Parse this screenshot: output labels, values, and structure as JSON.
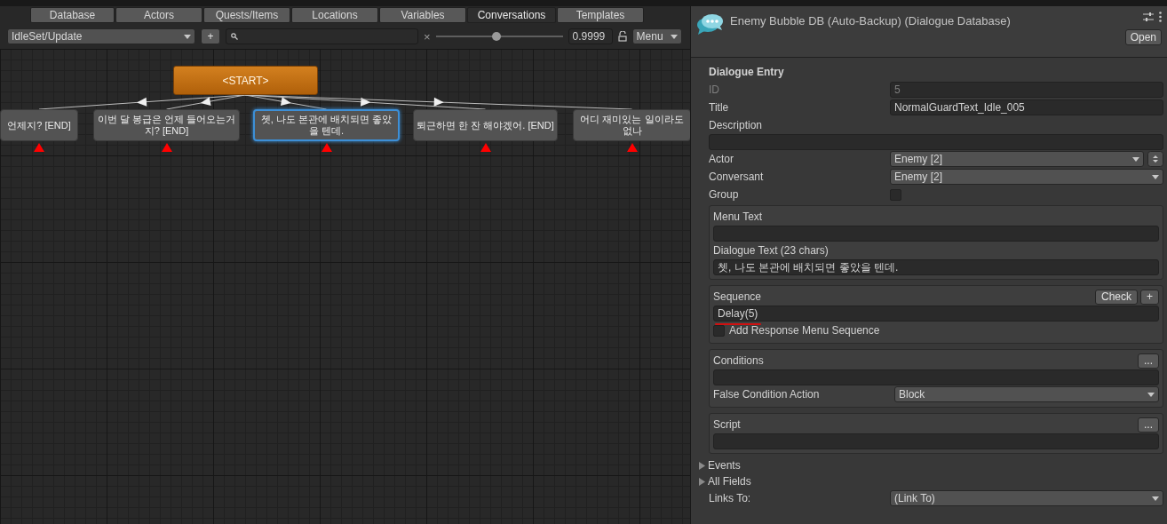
{
  "editor_tabs": [
    {
      "label": "Database",
      "selected": false
    },
    {
      "label": "Actors",
      "selected": false
    },
    {
      "label": "Quests/Items",
      "selected": false
    },
    {
      "label": "Locations",
      "selected": false
    },
    {
      "label": "Variables",
      "selected": false
    },
    {
      "label": "Conversations",
      "selected": true
    },
    {
      "label": "Templates",
      "selected": false
    }
  ],
  "toolbar": {
    "conversation": "IdleSet/Update",
    "add_button": "+",
    "clear_glyph": "×",
    "zoom": {
      "level": 0.48
    },
    "zoom_value": "0.9999",
    "menu": "Menu"
  },
  "graph": {
    "start_node": "<START>",
    "nodes": [
      {
        "text": "언제지? [END]",
        "selected": false
      },
      {
        "text": "이번 달 봉급은 언제 들어오는거지? [END]",
        "selected": false
      },
      {
        "text": "쳇, 나도 본관에 배치되면 좋았을 텐데.",
        "selected": true
      },
      {
        "text": "퇴근하면 한 잔 해야겠어.  [END]",
        "selected": false
      },
      {
        "text": "어디 재미있는 일이라도 없나",
        "selected": false
      }
    ]
  },
  "inspector": {
    "title": "Enemy Bubble DB (Auto-Backup) (Dialogue Database)",
    "open_button": "Open",
    "section": "Dialogue Entry",
    "fields": [
      {
        "kind": "text",
        "label": "ID",
        "value": "5",
        "disabled": true
      },
      {
        "kind": "text",
        "label": "Title",
        "value": "NormalGuardText_Idle_005",
        "disabled": false
      },
      {
        "kind": "area",
        "label": "Description"
      },
      {
        "kind": "dropdown",
        "label": "Actor",
        "value": "Enemy [2]",
        "spinner": true
      },
      {
        "kind": "dropdown",
        "label": "Conversant",
        "value": "Enemy [2]",
        "spinner": false
      },
      {
        "kind": "checkbox",
        "label": "Group",
        "checked": false
      },
      {
        "kind": "box",
        "fields": [
          {
            "kind": "area",
            "label": "Menu Text"
          },
          {
            "kind": "area",
            "label": "Dialogue Text (23 chars)",
            "value": "쳇, 나도 본관에 배치되면 좋았을 텐데."
          }
        ]
      },
      {
        "kind": "box",
        "fields": [
          {
            "kind": "area",
            "label": "Sequence",
            "buttons": [
              "Check",
              "+"
            ],
            "value": "Delay(5)",
            "misspelled": true
          },
          {
            "kind": "inline_checkbox",
            "label": "Add Response Menu Sequence",
            "checked": false
          }
        ]
      },
      {
        "kind": "box",
        "fields": [
          {
            "kind": "area",
            "label": "Conditions",
            "buttons": [
              "..."
            ]
          },
          {
            "kind": "dropdown",
            "label": "False Condition Action",
            "value": "Block",
            "spinner": false
          }
        ]
      },
      {
        "kind": "box",
        "fields": [
          {
            "kind": "area",
            "label": "Script",
            "buttons": [
              "..."
            ]
          }
        ]
      },
      {
        "kind": "foldout",
        "label": "Events",
        "expanded": false
      },
      {
        "kind": "foldout",
        "label": "All Fields",
        "expanded": false
      },
      {
        "kind": "dropdown",
        "label": "Links To:",
        "value": "(Link To)",
        "spinner": false
      }
    ]
  }
}
